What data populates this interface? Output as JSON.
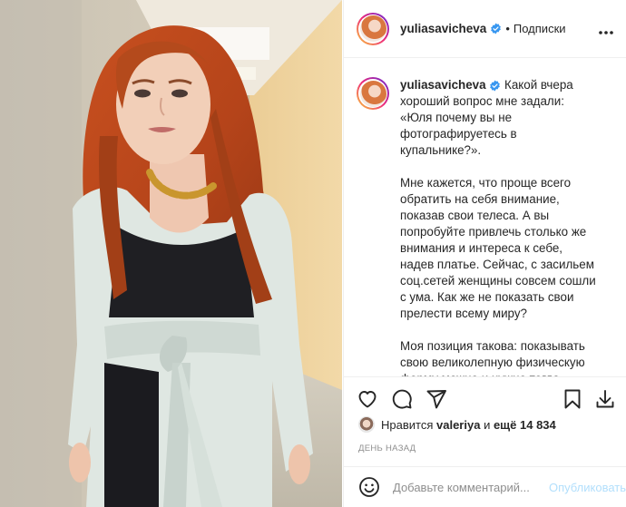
{
  "post": {
    "username": "yuliasavicheva",
    "separator": "•",
    "follow_label": "Подписки",
    "caption_username": "yuliasavicheva",
    "caption_p1": "Какой вчера хороший вопрос мне задали: «Юля почему вы не фотографируетесь в купальнике?».",
    "caption_p2": "Мне кажется, что проще всего обратить на себя внимание, показав свои телеса. А вы попробуйте привлечь столько же внимания и интереса к себе, надев платье. Сейчас, с засильем соц.сетей женщины совсем сошли с ума. Как же не показать свои прелести всему миру?",
    "caption_p3": "Моя позиция такова: показывать свою великолепную физическую форму можно и нужно тогда, когда ты родила уже несколько детей,"
  },
  "likes": {
    "prefix": "Нравится",
    "liker": "valeriya",
    "middle": "и",
    "others": "ещё 14 834"
  },
  "timestamp": "ДЕНЬ НАЗАД",
  "comment": {
    "placeholder": "Добавьте комментарий...",
    "publish_label": "Опубликовать"
  },
  "icons": {
    "more": "more-horizontal-icon",
    "like": "heart-icon",
    "comment": "comment-bubble-icon",
    "share": "paper-plane-icon",
    "save": "bookmark-icon",
    "download": "download-icon",
    "emoji": "smiley-icon",
    "verified": "verified-badge-icon"
  },
  "colors": {
    "text": "#262626",
    "muted": "#8e8e8e",
    "verified": "#3897f0",
    "publish_disabled": "#b2dffc",
    "border": "#efefef"
  }
}
